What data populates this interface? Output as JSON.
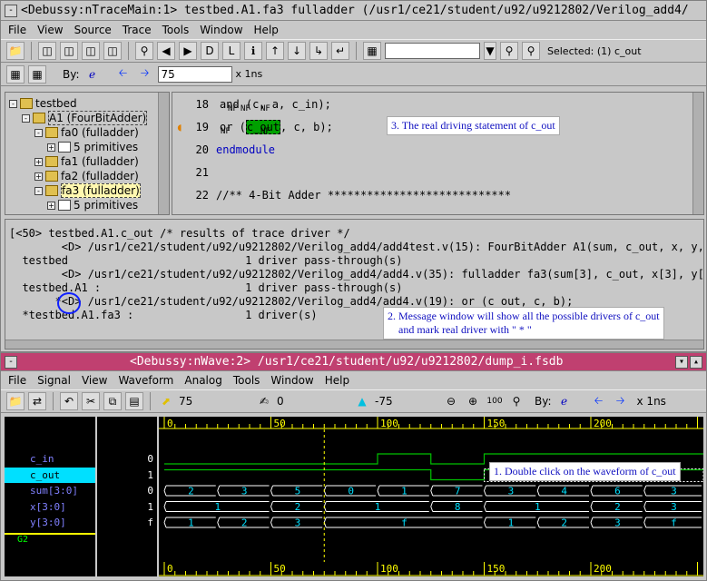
{
  "trace": {
    "title": "<Debussy:nTraceMain:1> testbed.A1.fa3 fulladder (/usr1/ce21/student/u92/u9212802/Verilog_add4/",
    "menu": [
      "File",
      "View",
      "Source",
      "Trace",
      "Tools",
      "Window",
      "Help"
    ],
    "selected": "Selected: (1) c_out",
    "by_label": "By:",
    "time_value": "75",
    "time_unit": "x 1ns",
    "tree": [
      {
        "label": "testbed",
        "indent": 0
      },
      {
        "label": "A1 (FourBitAdder)",
        "indent": 1
      },
      {
        "label": "fa0 (fulladder)",
        "indent": 2
      },
      {
        "label": "5 primitives",
        "indent": 3
      },
      {
        "label": "fa1 (fulladder)",
        "indent": 2
      },
      {
        "label": "fa2 (fulladder)",
        "indent": 2
      },
      {
        "label": "fa3 (fulladder)",
        "indent": 2
      },
      {
        "label": "5 primitives",
        "indent": 3
      }
    ],
    "source": [
      {
        "ln": "18",
        "code_pre": "and (",
        "hl": "c",
        "code_post": ", a, c_in);"
      },
      {
        "ln": "19",
        "code_pre": "or (",
        "hl": "c_out",
        "code_post": ", c, b);"
      },
      {
        "ln": "20",
        "code": "endmodule"
      },
      {
        "ln": "21",
        "code": ""
      },
      {
        "ln": "22",
        "code": "//** 4-Bit Adder ****************************"
      }
    ],
    "nf": "NF",
    "note1": "3. The real driving statement of c_out",
    "messages": [
      "[<50> testbed.A1.c_out /* results of trace driver */",
      "        <D> /usr1/ce21/student/u92/u9212802/Verilog_add4/add4test.v(15): FourBitAdder A1(sum, c_out, x, y,",
      "  testbed                           1 driver pass-through(s)",
      "        <D> /usr1/ce21/student/u92/u9212802/Verilog_add4/add4.v(35): fulladder fa3(sum[3], c_out, x[3], y[",
      "  testbed.A1 :                      1 driver pass-through(s)",
      "       *<D> /usr1/ce21/student/u92/u9212802/Verilog_add4/add4.v(19): or (c_out, c, b);",
      "  *testbed.A1.fa3 :                 1 driver(s)"
    ],
    "note2": "2. Message window will show all the possible drivers of c_out\n    and mark real driver with \" * \""
  },
  "wave": {
    "title": "<Debussy:nWave:2> /usr1/ce21/student/u92/u9212802/dump_i.fsdb",
    "menu": [
      "File",
      "Signal",
      "View",
      "Waveform",
      "Analog",
      "Tools",
      "Window",
      "Help"
    ],
    "cursor": "75",
    "marker": "0",
    "delta": "-75",
    "by_label": "By:",
    "unit": "x 1ns",
    "ruler": [
      "0",
      "50",
      "100",
      "150",
      "200"
    ],
    "signals": [
      {
        "name": "c_in",
        "value": "0"
      },
      {
        "name": "c_out",
        "value": "1"
      },
      {
        "name": "sum[3:0]",
        "value": "0"
      },
      {
        "name": "x[3:0]",
        "value": "1"
      },
      {
        "name": "y[3:0]",
        "value": "f"
      }
    ],
    "group": "G2",
    "bus_sum": [
      "2",
      "3",
      "5",
      "0",
      "1",
      "7",
      "3",
      "4",
      "6",
      "3"
    ],
    "bus_x": [
      "1",
      "2",
      "1",
      "8",
      "1",
      "2",
      "3"
    ],
    "bus_y": [
      "1",
      "2",
      "3",
      "f",
      "1",
      "2",
      "3",
      "f"
    ],
    "note3": "1. Double click on the waveform of c_out",
    "colors": {
      "bg": "#000000",
      "green": "#00c000",
      "yellow": "#ffff00",
      "cyan": "#00e0ff",
      "title": "#c04070"
    }
  }
}
